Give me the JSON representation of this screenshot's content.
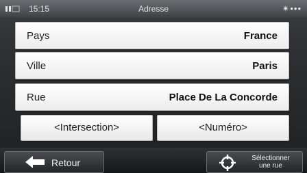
{
  "status": {
    "time": "15:15",
    "title": "Adresse",
    "signal_icon": "satellite-signal-icon",
    "battery_icon": "battery-icon"
  },
  "fields": [
    {
      "label": "Pays",
      "value": "France"
    },
    {
      "label": "Ville",
      "value": "Paris"
    },
    {
      "label": "Rue",
      "value": "Place De La Concorde"
    }
  ],
  "buttons": {
    "intersection": "<Intersection>",
    "numero": "<Numéro>",
    "back": "Retour",
    "select_line1": "Sélectionner",
    "select_line2": "une rue"
  }
}
